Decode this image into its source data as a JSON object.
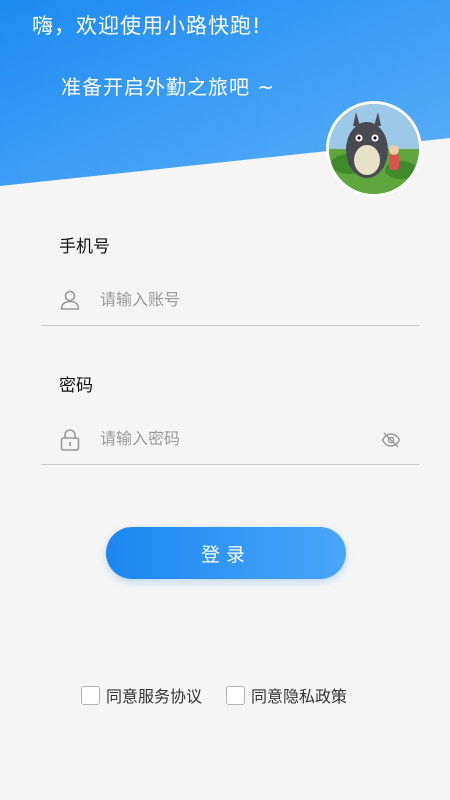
{
  "header": {
    "greeting": "嗨，欢迎使用小路快跑!",
    "subtitle": "准备开启外勤之旅吧 ~"
  },
  "form": {
    "phone": {
      "label": "手机号",
      "placeholder": "请输入账号",
      "value": "",
      "icon": "user-icon"
    },
    "password": {
      "label": "密码",
      "placeholder": "请输入密码",
      "value": "",
      "icon": "lock-icon",
      "toggle_icon": "eye-off-icon"
    }
  },
  "login_button": {
    "label": "登录"
  },
  "agreements": {
    "service_label": "同意服务协议",
    "service_checked": false,
    "privacy_label": "同意隐私政策",
    "privacy_checked": false
  },
  "colors": {
    "brand_blue": "#1a87f2",
    "brand_blue_light": "#4aa6f7",
    "background": "#f5f5f5"
  }
}
